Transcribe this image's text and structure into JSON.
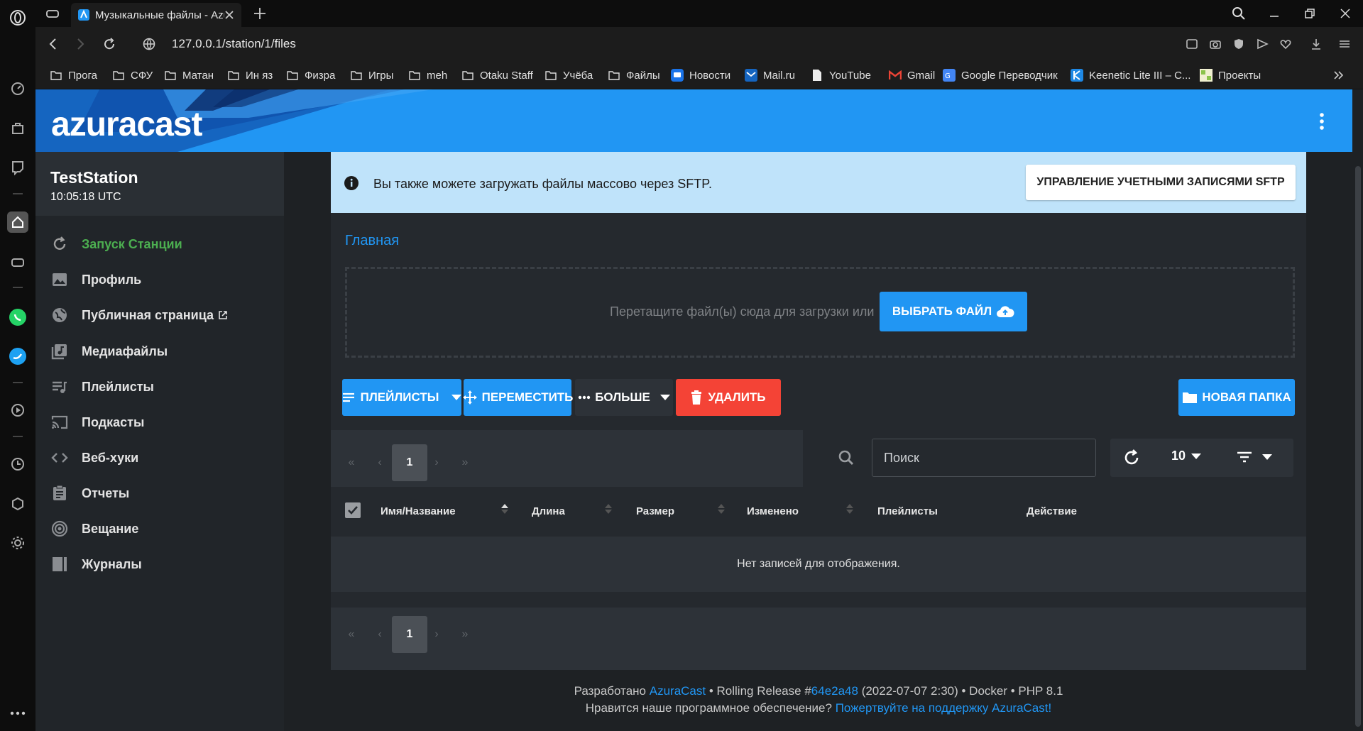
{
  "browser": {
    "tab_title": "Музыкальные файлы - AzuraCast",
    "url": "127.0.0.1/station/1/files",
    "bookmarks": [
      {
        "label": "Прога",
        "icon": "folder-icon"
      },
      {
        "label": "СФУ",
        "icon": "folder-icon"
      },
      {
        "label": "Матан",
        "icon": "folder-icon"
      },
      {
        "label": "Ин яз",
        "icon": "folder-icon"
      },
      {
        "label": "Физра",
        "icon": "folder-icon"
      },
      {
        "label": "Игры",
        "icon": "folder-icon"
      },
      {
        "label": "meh",
        "icon": "folder-icon"
      },
      {
        "label": "Otaku Staff",
        "icon": "folder-icon"
      },
      {
        "label": "Учёба",
        "icon": "folder-icon"
      },
      {
        "label": "Файлы",
        "icon": "folder-icon"
      },
      {
        "label": "Новости",
        "icon": "news-icon"
      },
      {
        "label": "Mail.ru",
        "icon": "mail-icon"
      },
      {
        "label": "YouTube",
        "icon": "page-icon"
      },
      {
        "label": "Gmail",
        "icon": "gmail-icon"
      },
      {
        "label": "Google Переводчик",
        "icon": "translate-icon"
      },
      {
        "label": "Keenetic Lite III – C...",
        "icon": "keenetic-icon"
      },
      {
        "label": "Проекты",
        "icon": "projects-icon"
      }
    ]
  },
  "header": {
    "logo": "azuracast"
  },
  "station": {
    "name": "TestStation",
    "time": "10:05:18 UTC"
  },
  "nav": [
    {
      "label": "Запуск Станции",
      "icon": "restart-icon",
      "active": true
    },
    {
      "label": "Профиль",
      "icon": "image-icon"
    },
    {
      "label": "Публичная страница",
      "icon": "globe-icon",
      "external": true
    },
    {
      "label": "Медиафайлы",
      "icon": "music-library-icon"
    },
    {
      "label": "Плейлисты",
      "icon": "playlist-icon"
    },
    {
      "label": "Подкасты",
      "icon": "cast-icon"
    },
    {
      "label": "Веб-хуки",
      "icon": "code-icon"
    },
    {
      "label": "Отчеты",
      "icon": "report-icon"
    },
    {
      "label": "Вещание",
      "icon": "broadcast-icon"
    },
    {
      "label": "Журналы",
      "icon": "logs-icon"
    }
  ],
  "sftp": {
    "text": "Вы также можете загружать файлы массово через SFTP.",
    "button": "УПРАВЛЕНИЕ УЧЕТНЫМИ ЗАПИСЯМИ SFTP"
  },
  "breadcrumb": "Главная",
  "upload": {
    "hint": "Перетащите файл(ы) сюда для загрузки или",
    "button": "ВЫБРАТЬ ФАЙЛ"
  },
  "toolbar": {
    "playlists": "ПЛЕЙЛИСТЫ",
    "move": "ПЕРЕМЕСТИТЬ",
    "more": "БОЛЬШЕ",
    "delete": "УДАЛИТЬ",
    "new_folder": "НОВАЯ ПАПКА"
  },
  "pager": {
    "first": "«",
    "prev": "‹",
    "current": "1",
    "next": "›",
    "last": "»"
  },
  "search": {
    "placeholder": "Поиск"
  },
  "per_page": "10",
  "table": {
    "columns": [
      "Имя/Название",
      "Длина",
      "Размер",
      "Изменено",
      "Плейлисты",
      "Действие"
    ],
    "empty": "Нет записей для отображения."
  },
  "footer": {
    "line1_prefix": "Разработано ",
    "line1_link": "AzuraCast",
    "line1_mid": " • Rolling Release #",
    "line1_hash": "64e2a48",
    "line1_suffix": " (2022-07-07 2:30) • Docker • PHP 8.1",
    "line2_prefix": "Нравится наше программное обеспечение? ",
    "line2_link": "Пожертвуйте на поддержку AzuraCast!"
  },
  "colors": {
    "accent": "#2196f3",
    "success": "#4caf50",
    "danger": "#f44336",
    "sftp_bg": "#bfe3fa"
  }
}
